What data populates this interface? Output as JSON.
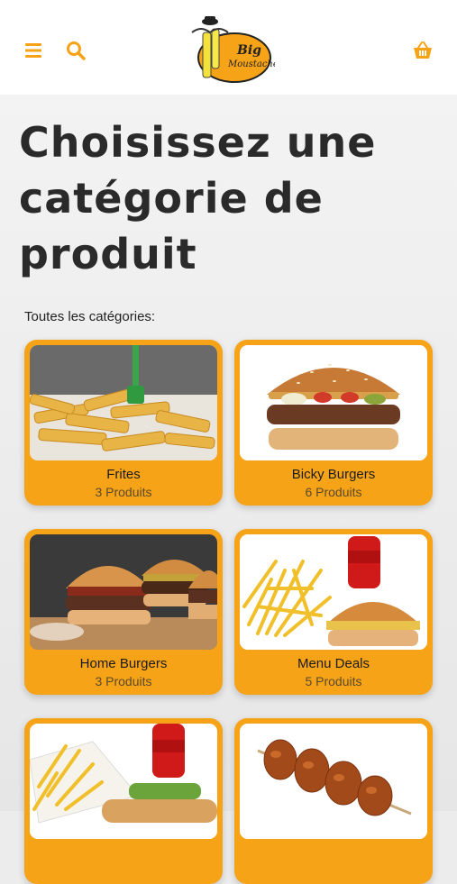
{
  "header": {
    "menu_icon": "hamburger-menu-icon",
    "search_icon": "search-icon",
    "basket_icon": "shopping-basket-icon",
    "brand_logo_text_1": "Big",
    "brand_logo_text_2": "Moustache",
    "accent_color": "#f7a318"
  },
  "page": {
    "title": "Choisissez une catégorie de produit",
    "subtitle": "Toutes les catégories:"
  },
  "categories": [
    {
      "name": "Frites",
      "count": "3 Produits"
    },
    {
      "name": "Bicky Burgers",
      "count": "6 Produits"
    },
    {
      "name": "Home Burgers",
      "count": "3 Produits"
    },
    {
      "name": "Menu Deals",
      "count": "5 Produits"
    },
    {
      "name": "",
      "count": ""
    },
    {
      "name": "",
      "count": ""
    }
  ]
}
